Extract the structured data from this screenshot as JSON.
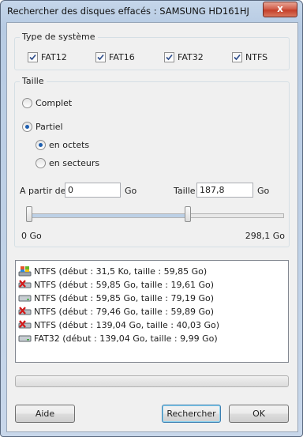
{
  "window": {
    "title": "Rechercher des disques effacés : SAMSUNG HD161HJ",
    "close_label": "x"
  },
  "filesystem": {
    "label": "Type de système",
    "options": [
      {
        "label": "FAT12",
        "checked": true
      },
      {
        "label": "FAT16",
        "checked": true
      },
      {
        "label": "FAT32",
        "checked": true
      },
      {
        "label": "NTFS",
        "checked": true
      }
    ]
  },
  "size": {
    "label": "Taille",
    "complete": "Complet",
    "partial": "Partiel",
    "bytes": "en octets",
    "sectors": "en secteurs",
    "from_label": "A partir de",
    "from_value": "0",
    "from_unit": "Go",
    "size_label": "Taille",
    "size_value": "187,8",
    "size_unit": "Go",
    "slider_min": "0 Go",
    "slider_max": "298,1 Go",
    "slider_from_fraction": 0.0,
    "slider_to_fraction": 0.63
  },
  "results": [
    {
      "icon": "ntfs-windows-icon",
      "text": "NTFS  (début : 31,5 Ko, taille : 59,85 Go)"
    },
    {
      "icon": "drive-deleted-icon",
      "text": "NTFS  (début : 59,85 Go, taille : 19,61 Go)"
    },
    {
      "icon": "drive-icon",
      "text": "NTFS  (début : 59,85 Go, taille : 79,19 Go)"
    },
    {
      "icon": "drive-deleted-icon",
      "text": "NTFS  (début : 79,46 Go, taille : 59,89 Go)"
    },
    {
      "icon": "drive-deleted-icon",
      "text": "NTFS  (début : 139,04 Go, taille : 40,03 Go)"
    },
    {
      "icon": "drive-icon",
      "text": "FAT32  (début : 139,04 Go, taille : 9,99 Go)"
    }
  ],
  "buttons": {
    "help": "Aide",
    "search": "Rechercher",
    "ok": "OK"
  }
}
